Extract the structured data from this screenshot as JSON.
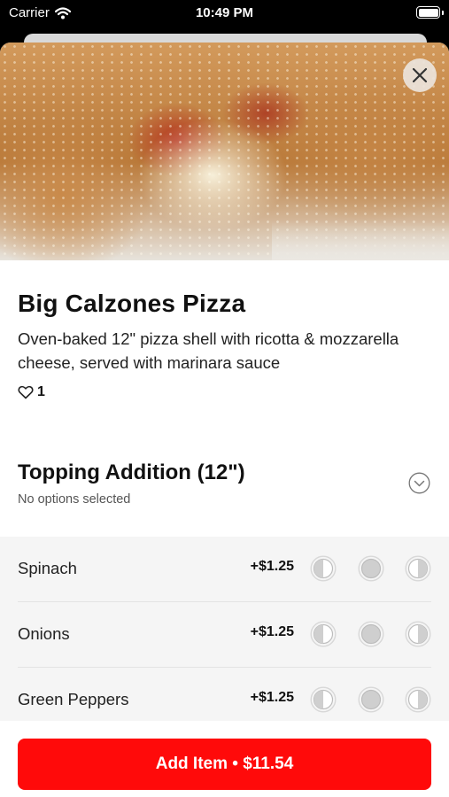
{
  "status_bar": {
    "carrier": "Carrier",
    "time": "10:49 PM"
  },
  "item": {
    "title": "Big Calzones Pizza",
    "description": "Oven-baked 12\" pizza shell with ricotta & mozzarella cheese, served with marinara sauce",
    "likes": "1"
  },
  "section": {
    "title": "Topping Addition (12\")",
    "subtitle": "No options selected"
  },
  "options": [
    {
      "name": "Spinach",
      "price": "+$1.25"
    },
    {
      "name": "Onions",
      "price": "+$1.25"
    },
    {
      "name": "Green Peppers",
      "price": "+$1.25"
    }
  ],
  "footer": {
    "add_label": "Add Item • $11.54"
  },
  "colors": {
    "accent": "#ff0a0a",
    "options_bg": "#f5f5f5"
  },
  "icons": {
    "close": "close-icon",
    "heart": "heart-icon",
    "chevron": "chevron-down-circle-icon",
    "portions": [
      "left-half-icon",
      "whole-icon",
      "right-half-icon"
    ]
  }
}
